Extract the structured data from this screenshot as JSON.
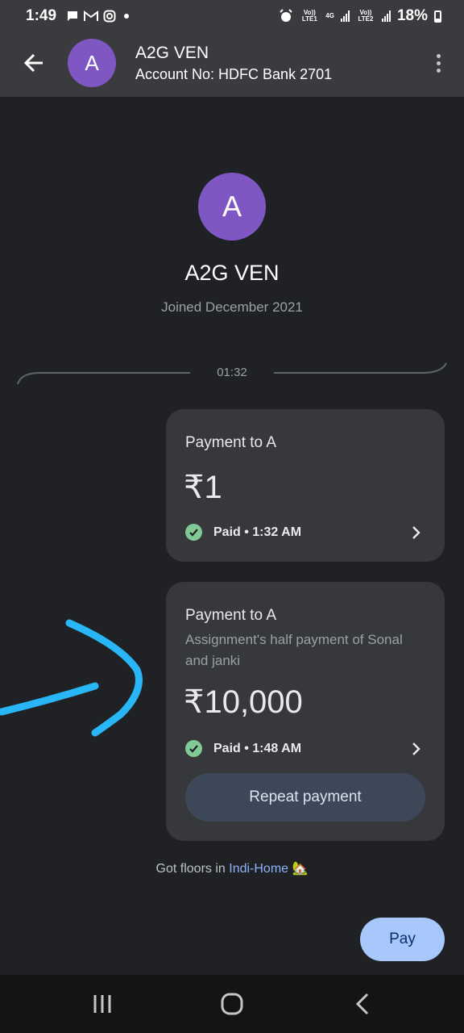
{
  "status_bar": {
    "time": "1:49",
    "battery": "18%",
    "sim1_label": "Vo)) LTE1",
    "net_label": "4G",
    "sim2_label": "Vo)) LTE2"
  },
  "header": {
    "avatar_letter": "A",
    "title": "A2G VEN",
    "subtitle": "Account No: HDFC Bank 2701"
  },
  "profile": {
    "avatar_letter": "A",
    "name": "A2G VEN",
    "joined": "Joined December 2021"
  },
  "divider_time": "01:32",
  "payments": [
    {
      "title": "Payment to A",
      "amount": "₹1",
      "status": "Paid • 1:32 AM"
    },
    {
      "title": "Payment to A",
      "note": "Assignment's half payment of Sonal and janki",
      "amount": "₹10,000",
      "status": "Paid • 1:48 AM",
      "action": "Repeat payment"
    }
  ],
  "footer": {
    "prefix": "Got floors in ",
    "link": "Indi-Home",
    "emoji": "🏡"
  },
  "pay_button": "Pay",
  "colors": {
    "background": "#202124",
    "avatar": "#7e57c2",
    "card": "#37383b",
    "paid_check": "#81c995",
    "link": "#8ab4f8",
    "pay_button": "#a8c7fa",
    "annotation_arrow": "#29b6f6"
  }
}
